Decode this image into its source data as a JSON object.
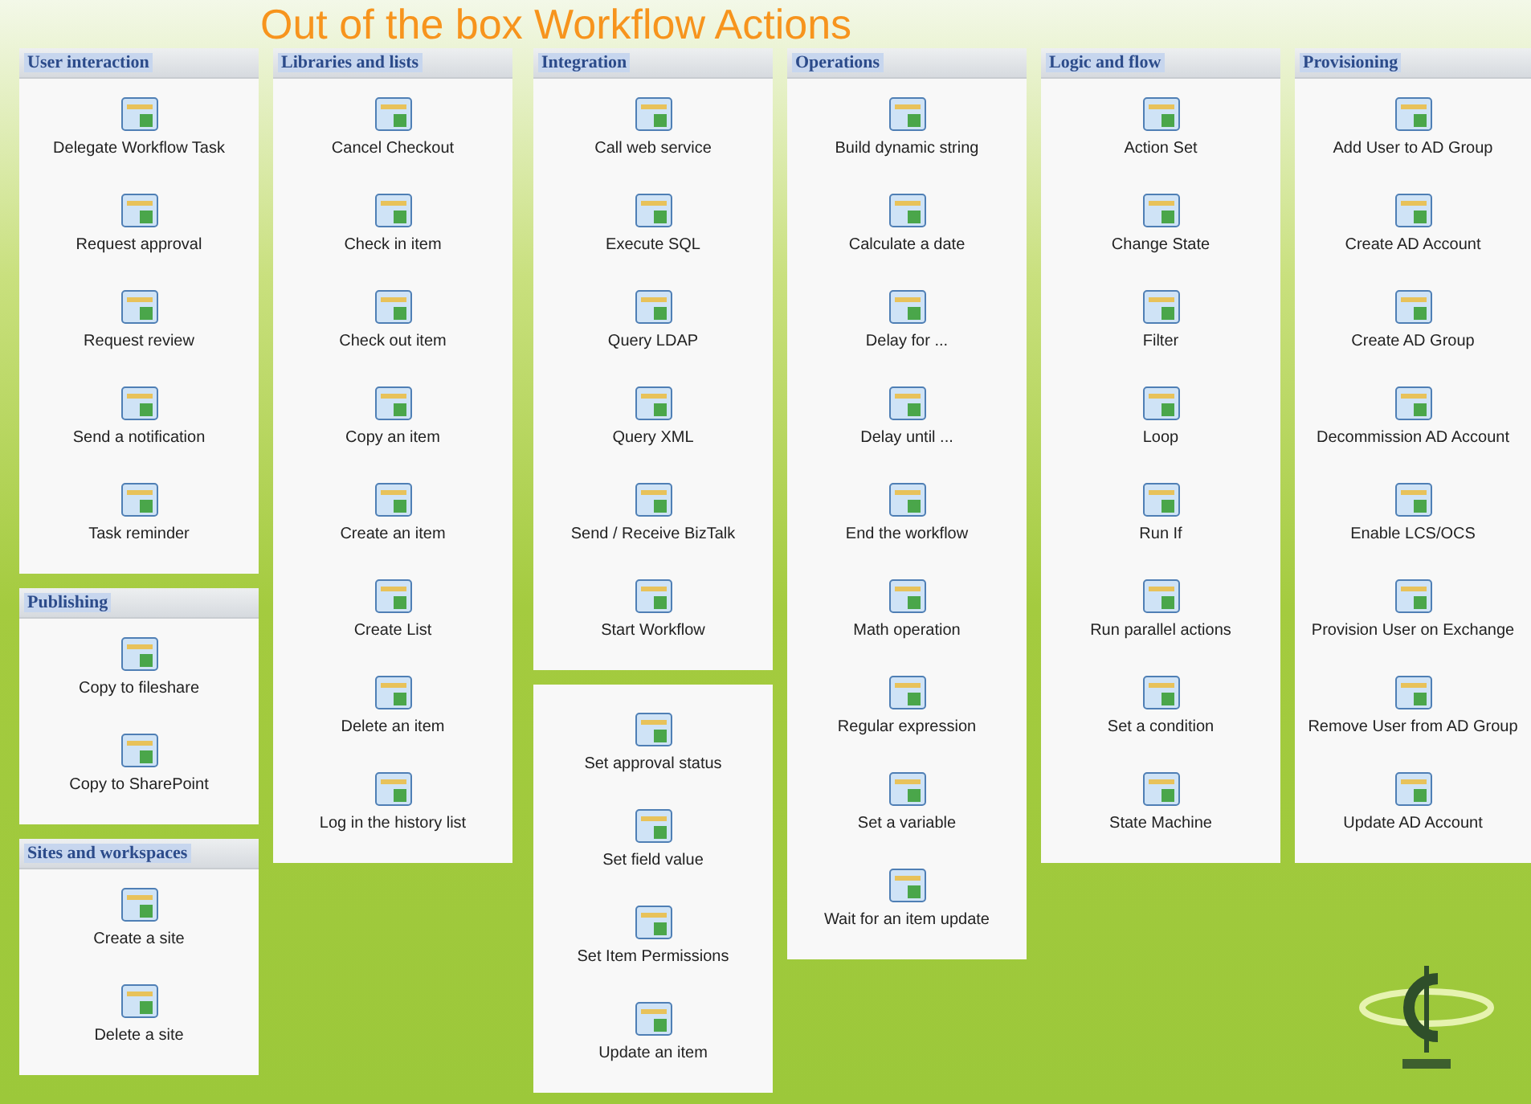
{
  "title": "Out of the box Workflow Actions",
  "columns": [
    {
      "panels": [
        {
          "heading": "User interaction",
          "items": [
            "Delegate Workflow Task",
            "Request approval",
            "Request review",
            "Send a notification",
            "Task reminder"
          ]
        },
        {
          "heading": "Publishing",
          "items": [
            "Copy to fileshare",
            "Copy to SharePoint"
          ]
        },
        {
          "heading": "Sites and workspaces",
          "items": [
            "Create a site",
            "Delete a site"
          ]
        }
      ]
    },
    {
      "panels": [
        {
          "heading": "Libraries and lists",
          "items": [
            "Cancel Checkout",
            "Check in item",
            "Check out item",
            "Copy an item",
            "Create an item",
            "Create List",
            "Delete an item",
            "Log in the history list"
          ]
        }
      ]
    },
    {
      "panels": [
        {
          "heading": "Integration",
          "items": [
            "Call web service",
            "Execute SQL",
            "Query LDAP",
            "Query XML",
            "Send / Receive BizTalk",
            "Start Workflow"
          ]
        },
        {
          "items": [
            "Set approval status",
            "Set field value",
            "Set Item Permissions",
            "Update an item"
          ]
        }
      ]
    },
    {
      "panels": [
        {
          "heading": "Operations",
          "items": [
            "Build dynamic string",
            "Calculate a date",
            "Delay for ...",
            "Delay until ...",
            "End the workflow",
            "Math operation",
            "Regular expression",
            "Set a variable",
            "Wait for an item update"
          ]
        }
      ]
    },
    {
      "panels": [
        {
          "heading": "Logic and flow",
          "items": [
            "Action Set",
            "Change State",
            "Filter",
            "Loop",
            "Run If",
            "Run parallel actions",
            "Set a condition",
            "State Machine"
          ]
        }
      ]
    },
    {
      "panels": [
        {
          "heading": "Provisioning",
          "items": [
            "Add User to AD Group",
            "Create AD Account",
            "Create AD Group",
            "Decommission AD Account",
            "Enable LCS/OCS",
            "Provision User on Exchange",
            "Remove User from AD Group",
            "Update AD Account"
          ]
        }
      ]
    }
  ]
}
